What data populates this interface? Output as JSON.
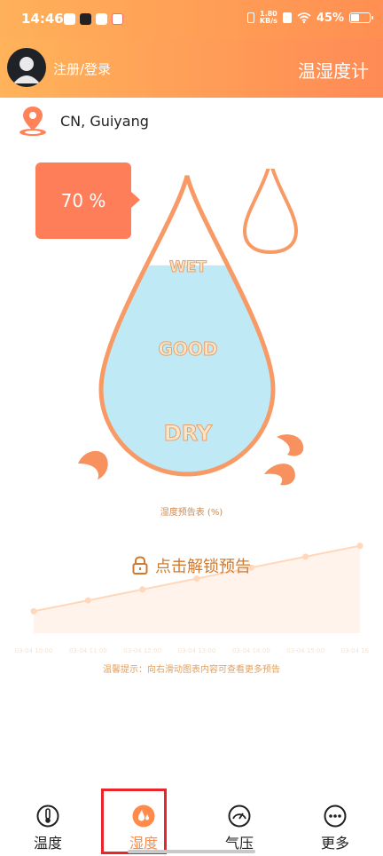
{
  "status_bar": {
    "time": "14:46",
    "net_speed_value": "1.80",
    "net_speed_unit": "KB/s",
    "battery_percent": "45%",
    "battery_level": 0.45
  },
  "header": {
    "login_label": "注册/登录",
    "title": "温湿度计"
  },
  "location": {
    "text": "CN, Guiyang"
  },
  "humidity": {
    "value": 70,
    "display": "70 %"
  },
  "gauge": {
    "wet_label": "WET",
    "good_label": "GOOD",
    "dry_label": "DRY",
    "level": 0.7
  },
  "forecast": {
    "title": "湿度预告表 (%)",
    "lock_text": "点击解锁预告",
    "tip": "温馨提示：向右滑动图表内容可查看更多预告"
  },
  "chart_data": {
    "type": "area",
    "title": "湿度预告表 (%)",
    "x": [
      "03-04 10:00",
      "03-04 11:00",
      "03-04 12:00",
      "03-04 13:00",
      "03-04 14:00",
      "03-04 15:00",
      "03-04 16:00"
    ],
    "series": [
      {
        "values": [
          58,
          62,
          66,
          70,
          74,
          78,
          82
        ]
      }
    ],
    "ylim": [
      50,
      90
    ],
    "grid": false,
    "color": "#ffb07a",
    "blurred": true
  },
  "tabs": [
    {
      "label": "温度",
      "icon": "thermometer-icon",
      "active": false
    },
    {
      "label": "湿度",
      "icon": "droplet-icon",
      "active": true
    },
    {
      "label": "气压",
      "icon": "gauge-icon",
      "active": false
    },
    {
      "label": "更多",
      "icon": "more-dots-icon",
      "active": false
    }
  ],
  "colors": {
    "accent": "#ff8a55",
    "header_start": "#ffb35a",
    "bubble": "#ff7e5a",
    "water": "#bfeaf5",
    "drop_stroke": "#f79a66"
  }
}
